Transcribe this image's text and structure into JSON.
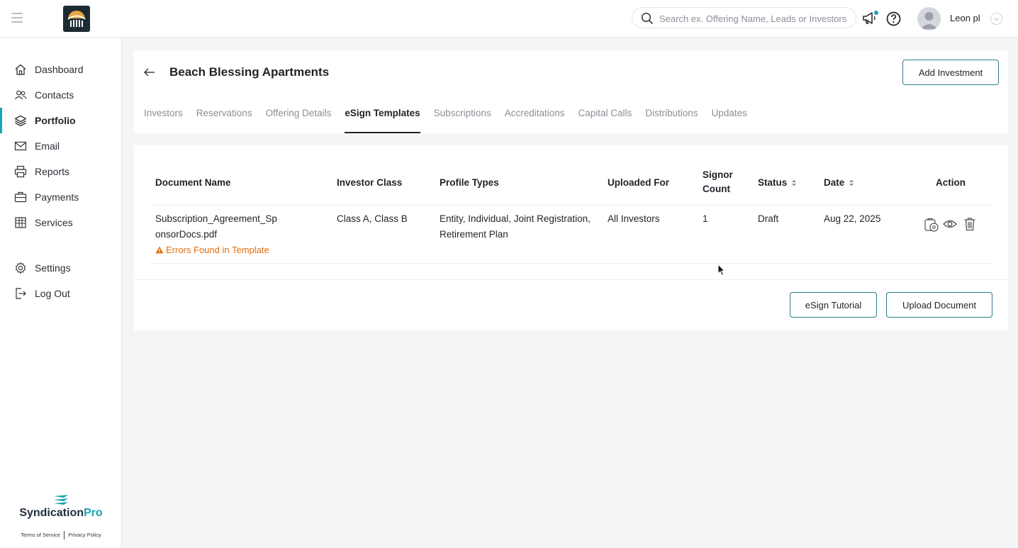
{
  "topbar": {
    "search_placeholder": "Search ex. Offering Name, Leads or Investors",
    "username": "Leon pl"
  },
  "sidebar": {
    "items": [
      {
        "label": "Dashboard",
        "icon": "home-icon"
      },
      {
        "label": "Contacts",
        "icon": "contacts-icon"
      },
      {
        "label": "Portfolio",
        "icon": "layers-icon",
        "active": true
      },
      {
        "label": "Email",
        "icon": "mail-icon"
      },
      {
        "label": "Reports",
        "icon": "printer-icon"
      },
      {
        "label": "Payments",
        "icon": "briefcase-icon"
      },
      {
        "label": "Services",
        "icon": "building-icon"
      },
      {
        "label": "Settings",
        "icon": "gear-icon"
      },
      {
        "label": "Log Out",
        "icon": "logout-icon"
      }
    ],
    "brand_name_main": "Syndication",
    "brand_name_accent": "Pro",
    "terms": "Terms of Service",
    "privacy": "Privacy Policy"
  },
  "header": {
    "title": "Beach Blessing Apartments",
    "add_button": "Add Investment",
    "tabs": [
      {
        "label": "Investors"
      },
      {
        "label": "Reservations"
      },
      {
        "label": "Offering Details"
      },
      {
        "label": "eSign Templates",
        "active": true
      },
      {
        "label": "Subscriptions"
      },
      {
        "label": "Accreditations"
      },
      {
        "label": "Capital Calls"
      },
      {
        "label": "Distributions"
      },
      {
        "label": "Updates"
      }
    ]
  },
  "table": {
    "columns": {
      "document_name": "Document Name",
      "investor_class": "Investor Class",
      "profile_types": "Profile Types",
      "uploaded_for": "Uploaded For",
      "signor_line1": "Signor",
      "signor_line2": "Count",
      "status": "Status",
      "date": "Date",
      "action": "Action"
    },
    "rows": [
      {
        "document_line1": "Subscription_Agreement_Sp",
        "document_line2": "onsorDocs.pdf",
        "error": "Errors Found in Template",
        "investor_class": "Class A, Class B",
        "profile_line1": "Entity, Individual, Joint Registration,",
        "profile_line2": "Retirement Plan",
        "uploaded_for": "All Investors",
        "signor_count": "1",
        "status": "Draft",
        "date": "Aug 22, 2025"
      }
    ],
    "esign_tutorial": "eSign Tutorial",
    "upload_document": "Upload Document"
  },
  "colors": {
    "accent": "#1aa3b5",
    "button_border": "#2d7c86",
    "error": "#e0700f"
  }
}
